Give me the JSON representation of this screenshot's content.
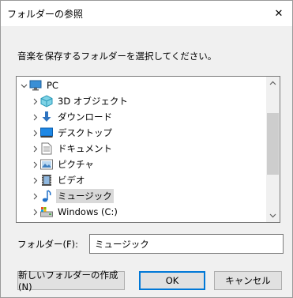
{
  "window": {
    "title": "フォルダーの参照",
    "close_symbol": "✕"
  },
  "instruction": "音楽を保存するフォルダーを選択してください。",
  "tree": {
    "items": [
      {
        "label": "PC",
        "icon": "computer-icon",
        "expander": "open"
      },
      {
        "label": "3D オブジェクト",
        "icon": "3d-objects-icon",
        "expander": "closed"
      },
      {
        "label": "ダウンロード",
        "icon": "download-icon",
        "expander": "closed"
      },
      {
        "label": "デスクトップ",
        "icon": "desktop-icon",
        "expander": "closed"
      },
      {
        "label": "ドキュメント",
        "icon": "documents-icon",
        "expander": "closed"
      },
      {
        "label": "ピクチャ",
        "icon": "pictures-icon",
        "expander": "closed"
      },
      {
        "label": "ビデオ",
        "icon": "videos-icon",
        "expander": "closed"
      },
      {
        "label": "ミュージック",
        "icon": "music-icon",
        "expander": "closed",
        "selected": true
      },
      {
        "label": "Windows (C:)",
        "icon": "drive-icon",
        "expander": "closed"
      }
    ]
  },
  "folder_field": {
    "label": "フォルダー(F):",
    "value": "ミュージック"
  },
  "buttons": {
    "new_folder": "新しいフォルダーの作成(N)",
    "ok": "OK",
    "cancel": "キャンセル"
  },
  "colors": {
    "accent": "#0078d7",
    "selection": "#d9d9d9"
  }
}
